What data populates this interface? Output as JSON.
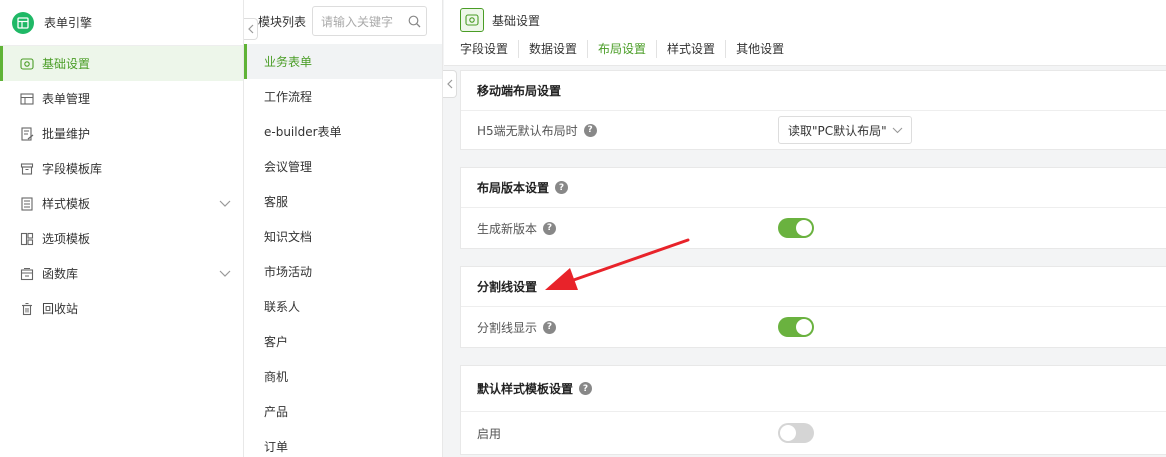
{
  "brand": {
    "title": "表单引擎"
  },
  "sidebar": {
    "items": [
      {
        "label": "基础设置",
        "icon": "gear-icon",
        "active": true
      },
      {
        "label": "表单管理",
        "icon": "table-icon"
      },
      {
        "label": "批量维护",
        "icon": "edit-doc-icon"
      },
      {
        "label": "字段模板库",
        "icon": "box-icon"
      },
      {
        "label": "样式模板",
        "icon": "doc-list-icon",
        "expandable": true
      },
      {
        "label": "选项模板",
        "icon": "options-icon"
      },
      {
        "label": "函数库",
        "icon": "function-icon",
        "expandable": true
      },
      {
        "label": "回收站",
        "icon": "trash-icon"
      }
    ]
  },
  "modules": {
    "title": "模块列表",
    "search_placeholder": "请输入关键字",
    "items": [
      "业务表单",
      "工作流程",
      "e-builder表单",
      "会议管理",
      "客服",
      "知识文档",
      "市场活动",
      "联系人",
      "客户",
      "商机",
      "产品",
      "订单"
    ],
    "active_index": 0
  },
  "page": {
    "title": "基础设置",
    "tabs": [
      "字段设置",
      "数据设置",
      "布局设置",
      "样式设置",
      "其他设置"
    ],
    "active_tab": 2
  },
  "sections": {
    "mobile": {
      "title": "移动端布局设置",
      "row_label": "H5端无默认布局时",
      "select_value": "读取\"PC默认布局\""
    },
    "version": {
      "title": "布局版本设置",
      "row_label": "生成新版本",
      "toggle_on": true
    },
    "divider": {
      "title": "分割线设置",
      "row_label": "分割线显示",
      "toggle_on": true
    },
    "default_style": {
      "title": "默认样式模板设置",
      "row_label": "启用",
      "toggle_on": false
    }
  },
  "colors": {
    "accent": "#4a9d26",
    "toggle_on": "#6ab23f",
    "annotation_arrow": "#e8232a"
  }
}
